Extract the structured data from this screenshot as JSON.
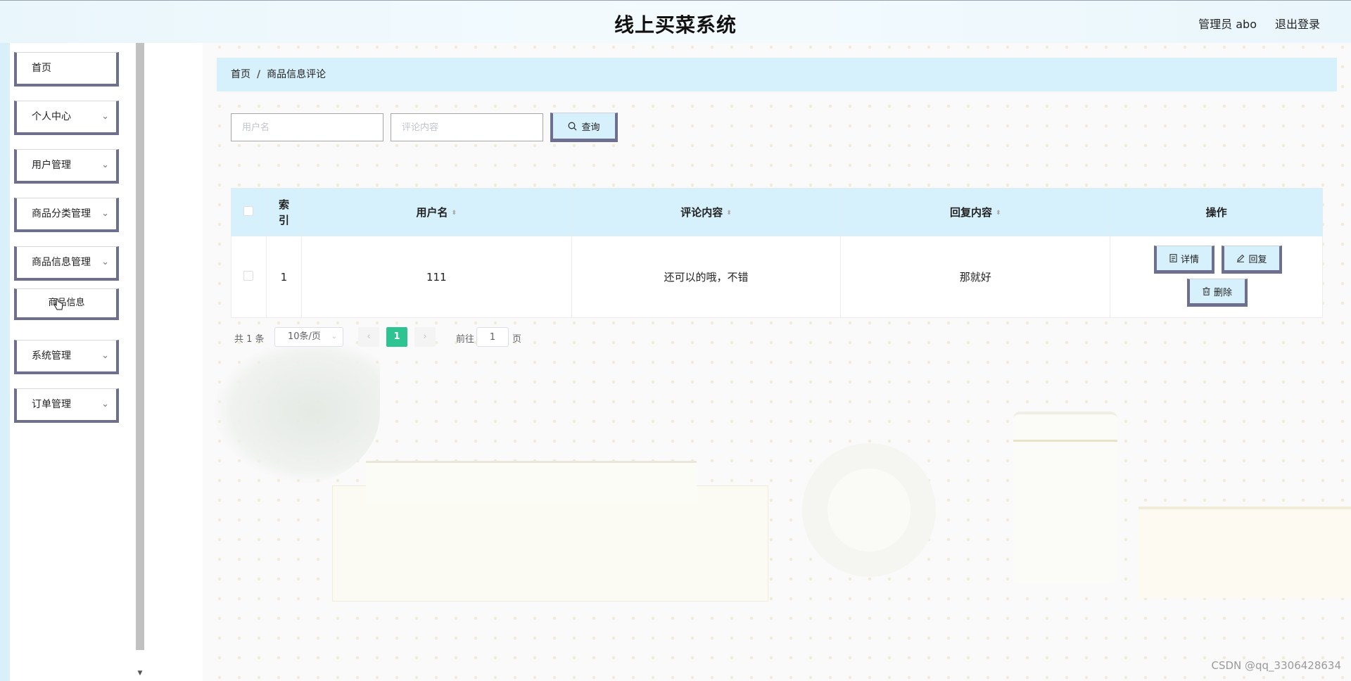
{
  "header": {
    "title": "线上买菜系统",
    "user_label": "管理员 abo",
    "logout_label": "退出登录"
  },
  "sidebar": {
    "items": [
      {
        "label": "首页",
        "has_chevron": false
      },
      {
        "label": "个人中心",
        "has_chevron": true
      },
      {
        "label": "用户管理",
        "has_chevron": true
      },
      {
        "label": "商品分类管理",
        "has_chevron": true
      },
      {
        "label": "商品信息管理",
        "has_chevron": true
      },
      {
        "label": "系统管理",
        "has_chevron": true
      },
      {
        "label": "订单管理",
        "has_chevron": true
      }
    ],
    "sub_item": {
      "label": "商品信息"
    },
    "chevron_icon": "chevron-down-icon"
  },
  "breadcrumb": {
    "home": "首页",
    "separator": "/",
    "current": "商品信息评论"
  },
  "search": {
    "username_placeholder": "用户名",
    "comment_placeholder": "评论内容",
    "button_label": "查询",
    "button_icon": "search-icon"
  },
  "table": {
    "headers": {
      "index": "索\n引",
      "username": "用户名",
      "comment": "评论内容",
      "reply": "回复内容",
      "actions": "操作"
    },
    "rows": [
      {
        "index": "1",
        "username": "111",
        "comment": "还可以的哦，不错",
        "reply": "那就好"
      }
    ],
    "actions": {
      "detail": "详情",
      "reply": "回复",
      "delete": "删除"
    }
  },
  "pagination": {
    "total": "共 1 条",
    "page_size": "10条/页",
    "current_page": "1",
    "goto_prefix": "前往",
    "goto_value": "1",
    "goto_suffix": "页"
  },
  "watermark": "CSDN @qq_3306428634",
  "colors": {
    "header_bg": "#e9f6fc",
    "accent_light_blue": "#d6f0fc",
    "button_border": "#6e6e8f",
    "pager_active": "#2ec491"
  }
}
